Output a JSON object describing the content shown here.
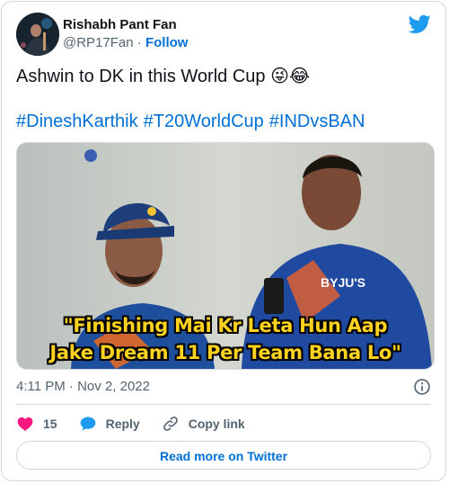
{
  "author": {
    "display_name": "Rishabh Pant Fan",
    "handle": "@RP17Fan",
    "separator": "·",
    "follow_label": "Follow"
  },
  "tweet": {
    "text": "Ashwin to DK in this World Cup 😜😂",
    "hashtags": [
      "#DineshKarthik",
      "#T20WorldCup",
      "#INDvsBAN"
    ]
  },
  "media": {
    "caption_line1": "\"Finishing Mai Kr Leta Hun Aap",
    "caption_line2": "Jake Dream 11 Per Team Bana Lo\""
  },
  "timestamp": {
    "time": "4:11 PM",
    "separator": "·",
    "date": "Nov 2, 2022"
  },
  "actions": {
    "like_count": "15",
    "reply_label": "Reply",
    "copy_link_label": "Copy link"
  },
  "read_more_label": "Read more on Twitter",
  "colors": {
    "link": "#006fd6",
    "heart": "#f91880",
    "twitter_blue": "#1d9bf0",
    "border": "#cfd9de",
    "secondary_text": "#536471"
  },
  "icons": [
    "twitter-bird-icon",
    "info-icon",
    "heart-icon",
    "reply-bubble-icon",
    "link-icon"
  ]
}
